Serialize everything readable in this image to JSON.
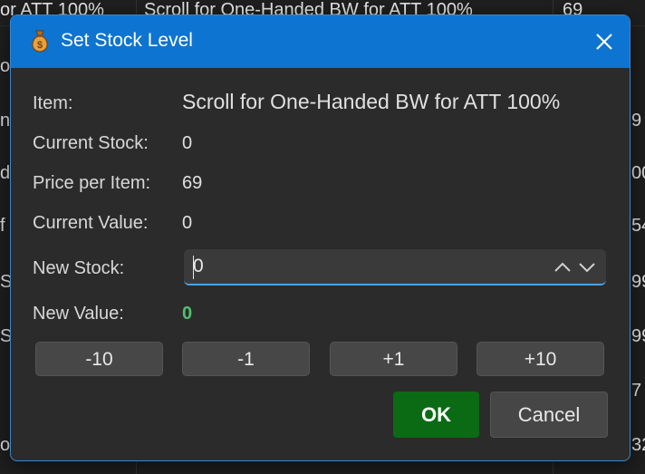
{
  "background": {
    "row1": {
      "col1": "or ATT 100%",
      "col2": "Scroll for One-Handed BW for ATT 100%",
      "col3": "69"
    },
    "left_fragments": [
      "or",
      "ng",
      "d",
      "f",
      "S",
      "S",
      "or"
    ],
    "right_fragments": [
      "9",
      "00",
      "54",
      "99",
      "99",
      "7",
      "32"
    ]
  },
  "dialog": {
    "title": "Set Stock Level",
    "icon": "money-bag-icon",
    "fields": {
      "item_label": "Item:",
      "item_value": "Scroll for One-Handed BW for ATT 100%",
      "current_stock_label": "Current Stock:",
      "current_stock_value": "0",
      "price_label": "Price per Item:",
      "price_value": "69",
      "current_value_label": "Current Value:",
      "current_value_value": "0",
      "new_stock_label": "New Stock:",
      "new_stock_input": "0",
      "new_value_label": "New Value:",
      "new_value_value": "0"
    },
    "step_buttons": [
      "-10",
      "-1",
      "+1",
      "+10"
    ],
    "ok_label": "OK",
    "cancel_label": "Cancel"
  }
}
